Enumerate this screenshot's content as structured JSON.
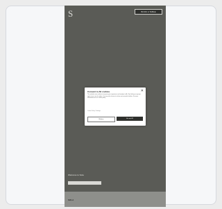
{
  "header": {
    "logo": "S",
    "tagline": "",
    "button_label": "BOOK A TABLE"
  },
  "cookie_modal": {
    "title": "Consent to All cookies",
    "close": "✕",
    "body": "This website uses cookies to improve your experience and analyze traffic. By clicking accept you agree to our use of cookies. You may also choose to refuse non-essential cookies. For more information see our cookie policy.",
    "policy_link": "Cookie Policy / Settings",
    "refuse_label": "Refuse",
    "accept_label": "Accept All"
  },
  "promo": {
    "title": "Welcome to Sola",
    "text": "",
    "button_label": ""
  },
  "footer": {
    "logo": "SOLA",
    "text": ""
  }
}
